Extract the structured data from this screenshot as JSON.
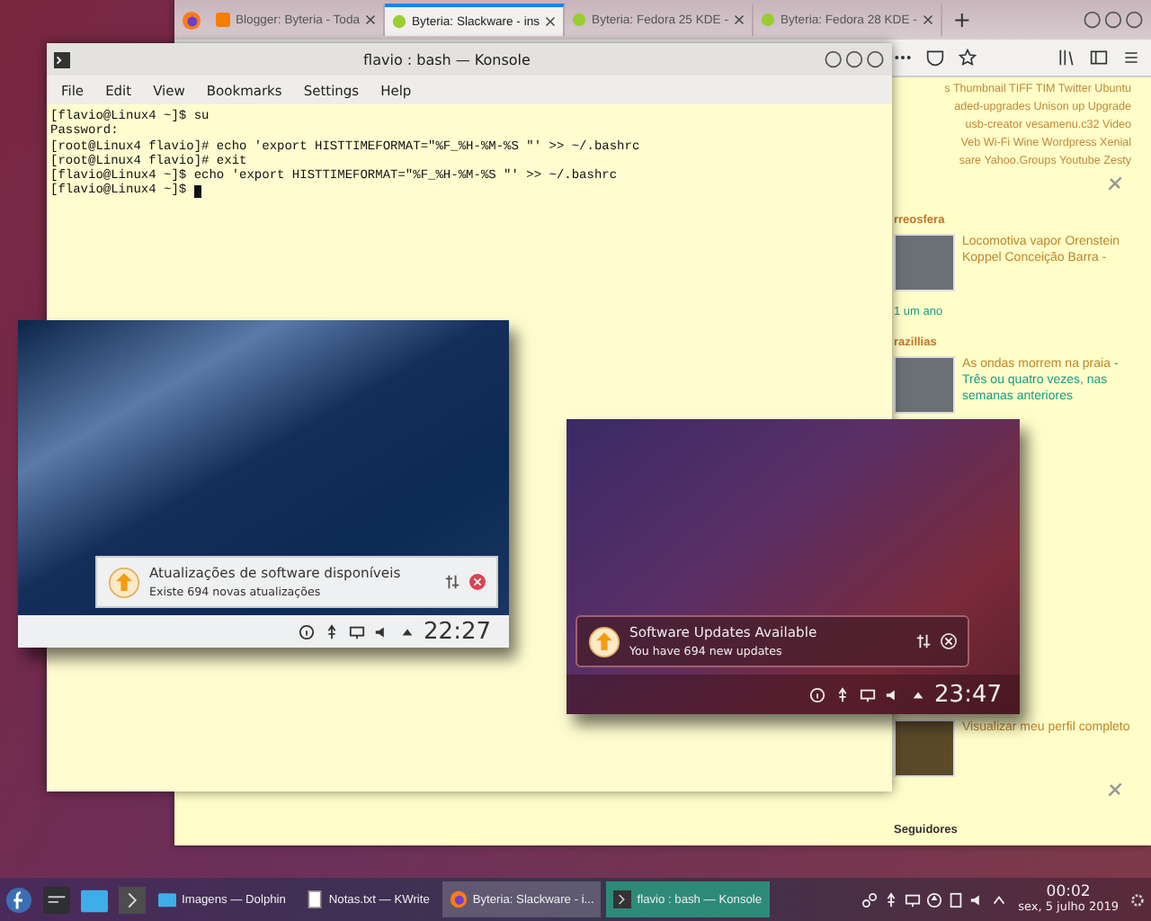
{
  "firefox": {
    "tabs": [
      {
        "title": "Blogger: Byteria - Toda",
        "kind": "blogger",
        "selected": false
      },
      {
        "title": "Byteria: Slackware - ins",
        "kind": "site",
        "selected": true
      },
      {
        "title": "Byteria: Fedora 25 KDE -",
        "kind": "site",
        "selected": false
      },
      {
        "title": "Byteria: Fedora 28 KDE -",
        "kind": "site",
        "selected": false
      }
    ],
    "new_tab": "+",
    "tag_cloud": [
      "s Thumbnail TIFF TIM Twitter Ubuntu",
      "aded-upgrades Unison up Upgrade",
      "usb-creator vesamenu.c32 Video",
      "Veb Wi-Fi Wine Wordpress Xenial",
      "sare Yahoo.Groups Youtube Zesty"
    ],
    "blogroll": [
      {
        "heading": "rreosfera",
        "post_title": "Locomotiva vapor Orenstein Koppel Conceição Barra -",
        "age": "1 um ano"
      },
      {
        "heading": "razillias",
        "post_title": "As ondas morrem na praia",
        "excerpt": "- Três ou quatro vezes, nas semanas anteriores"
      }
    ],
    "profile_link": "Visualizar meu perfil completo",
    "followers_heading": "Seguidores"
  },
  "konsole": {
    "title": "flavio : bash — Konsole",
    "menu": [
      "File",
      "Edit",
      "View",
      "Bookmarks",
      "Settings",
      "Help"
    ],
    "lines": [
      "[flavio@Linux4 ~]$ su",
      "Password:",
      "[root@Linux4 flavio]# echo 'export HISTTIMEFORMAT=\"%F_%H-%M-%S \"' >> ~/.bashrc",
      "[root@Linux4 flavio]# exit",
      "[flavio@Linux4 ~]$ echo 'export HISTTIMEFORMAT=\"%F_%H-%M-%S \"' >> ~/.bashrc",
      "[flavio@Linux4 ~]$ "
    ]
  },
  "screenshots": [
    {
      "kind": "light",
      "notification": {
        "title": "Atualizações de software disponíveis",
        "body": "Existe 694 novas atualizações"
      },
      "clock": "22:27"
    },
    {
      "kind": "dark",
      "notification": {
        "title": "Software Updates Available",
        "body": "You have 694 new updates"
      },
      "clock": "23:47"
    }
  ],
  "taskbar": {
    "tasks": [
      {
        "label": "Imagens — Dolphin",
        "kind": "folder",
        "selected": false
      },
      {
        "label": "Notas.txt — KWrite",
        "kind": "text",
        "selected": false
      },
      {
        "label": "Byteria: Slackware - i...",
        "kind": "browser",
        "selected": false
      },
      {
        "label": "flavio : bash — Konsole",
        "kind": "terminal",
        "selected": true
      }
    ],
    "time": "00:02",
    "date": "sex, 5 julho 2019"
  }
}
